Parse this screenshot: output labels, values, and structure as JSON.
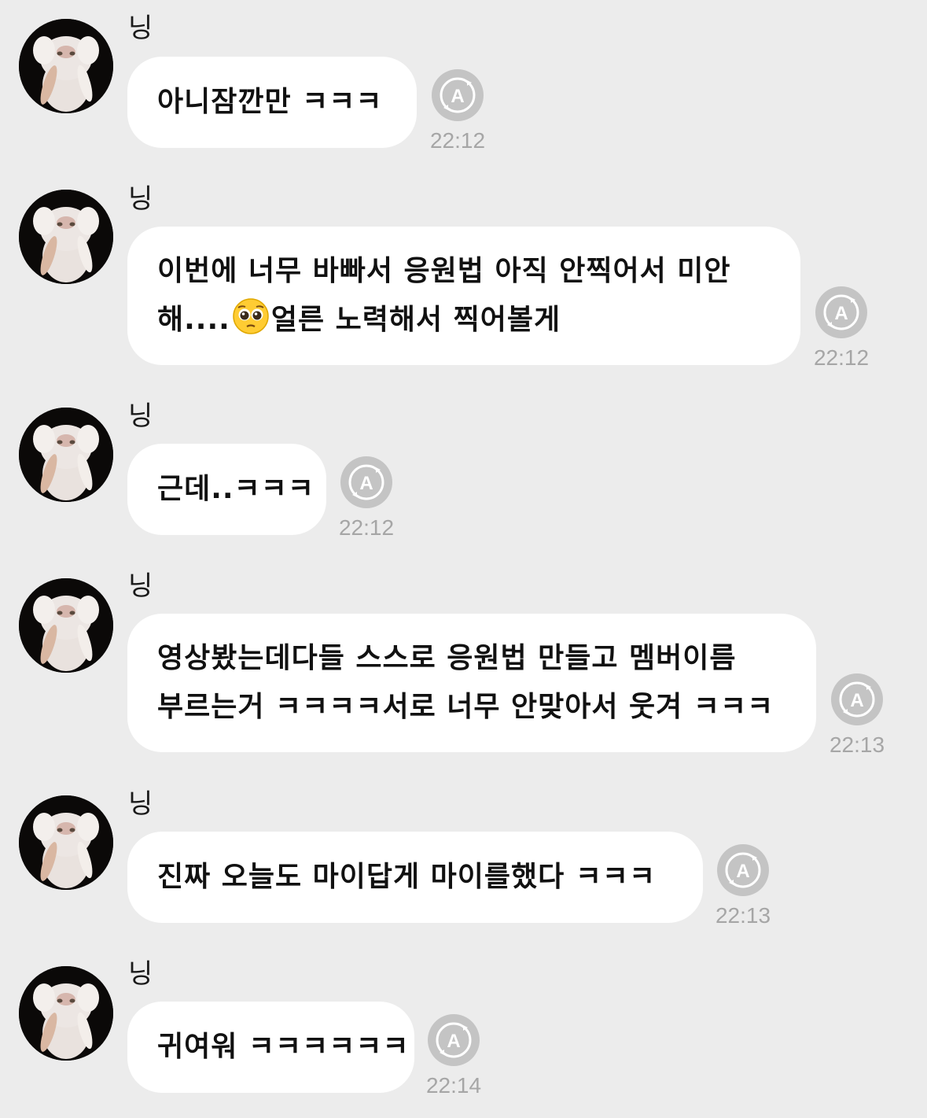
{
  "messages": [
    {
      "sender": "닝",
      "lines": [
        "아니잠깐만 ㅋㅋㅋ"
      ],
      "time": "22:12"
    },
    {
      "sender": "닝",
      "lines": [
        "이번에 너무 바빠서 응원법 아직 안찍어서 미안",
        "해....",
        "얼른 노력해서 찍어볼게"
      ],
      "time": "22:12",
      "emoji": "pleading-face"
    },
    {
      "sender": "닝",
      "lines": [
        "근데..ㅋㅋㅋ"
      ],
      "time": "22:12"
    },
    {
      "sender": "닝",
      "lines": [
        " 영상봤는데다들 스스로 응원법 만들고 멤버이름",
        "부르는거 ㅋㅋㅋㅋ서로 너무 안맞아서 웃겨 ㅋㅋㅋ"
      ],
      "time": "22:13"
    },
    {
      "sender": "닝",
      "lines": [
        "진짜 오늘도 마이답게 마이를했다 ㅋㅋㅋ"
      ],
      "time": "22:13"
    },
    {
      "sender": "닝",
      "lines": [
        "귀여워 ㅋㅋㅋㅋㅋㅋ"
      ],
      "time": "22:14"
    }
  ],
  "icons": {
    "avatar": "cat-photo",
    "translate": "auto-translate-icon"
  },
  "colors": {
    "background": "#ececec",
    "bubble": "#ffffff",
    "timestamp": "#a6a6a6",
    "icon": "#c4c4c4"
  }
}
